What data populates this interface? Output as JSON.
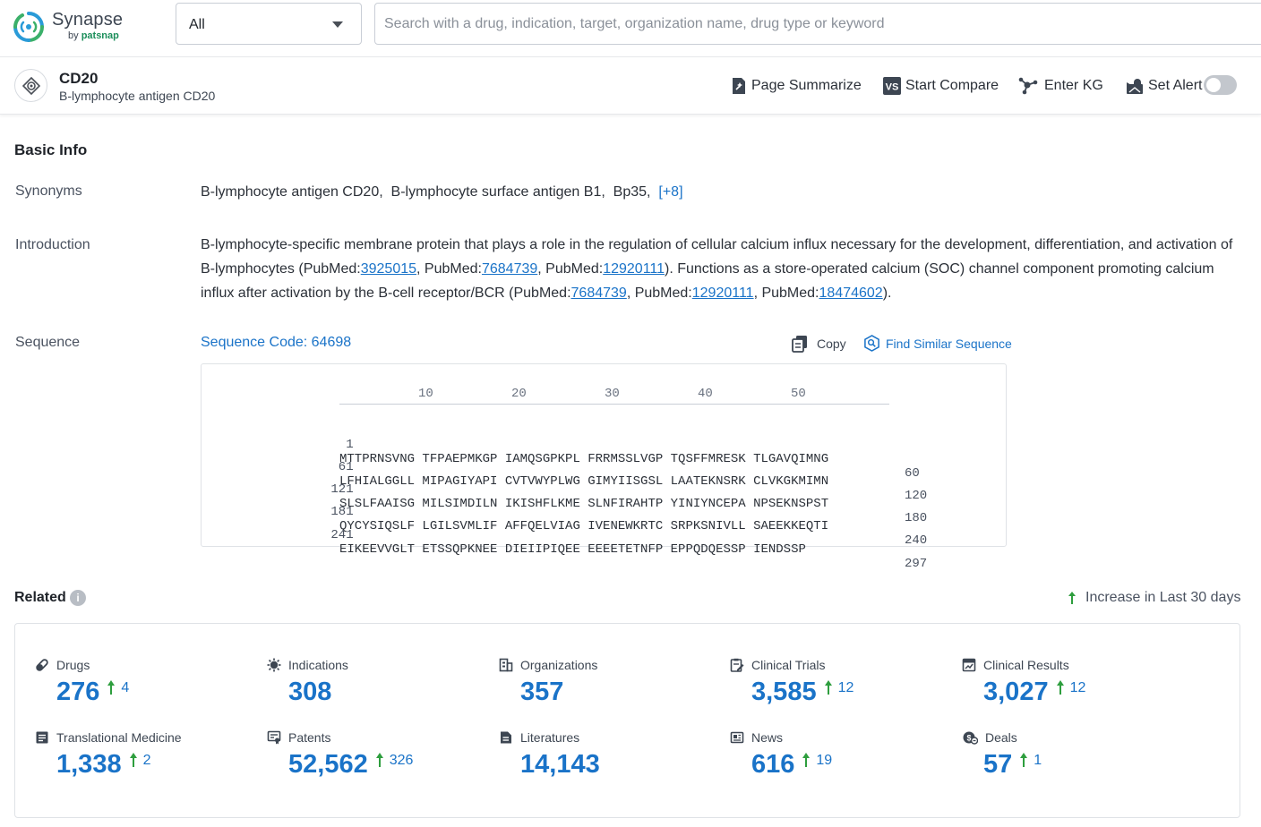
{
  "header": {
    "logo_name": "Synapse",
    "logo_by": "by",
    "logo_brand": "patsnap",
    "scope_value": "All",
    "search_placeholder": "Search with a drug, indication, target, organization name, drug type or keyword"
  },
  "entity": {
    "name": "CD20",
    "full_name": "B-lymphocyte antigen CD20",
    "actions": {
      "summarize": "Page Summarize",
      "compare": "Start Compare",
      "compare_badge": "VS",
      "kg": "Enter KG",
      "alert": "Set Alert",
      "alert_enabled": false
    }
  },
  "basic_info": {
    "title": "Basic Info",
    "synonyms_label": "Synonyms",
    "synonyms_text": "B-lymphocyte antigen CD20,  B-lymphocyte surface antigen B1,  Bp35,",
    "synonyms_more": "[+8]",
    "introduction_label": "Introduction",
    "intro": {
      "p1": "B-lymphocyte-specific membrane protein that plays a role in the regulation of cellular calcium influx necessary for the development, differentiation, and activation of B-lymphocytes (PubMed:",
      "l1": "3925015",
      "p2": ", PubMed:",
      "l2": "7684739",
      "p3": ", PubMed:",
      "l3": "12920111",
      "p4": "). Functions as a store-operated calcium (SOC) channel component promoting calcium influx after activation by the B-cell receptor/BCR (PubMed:",
      "l4": "7684739",
      "p5": ", PubMed:",
      "l5": "12920111",
      "p6": ", PubMed:",
      "l6": "18474602",
      "p7": ")."
    },
    "sequence_label": "Sequence",
    "sequence_code": "Sequence Code: 64698",
    "copy_label": "Copy",
    "find_similar_label": "Find Similar Sequence",
    "ruler_ticks": [
      "10",
      "20",
      "30",
      "40",
      "50"
    ],
    "sequence_rows": [
      {
        "start": "1",
        "residues": "MTTPRNSVNG TFPAEPMKGP IAMQSGPKPL FRRMSSLVGP TQSFFMRESK TLGAVQIMNG",
        "end": "60"
      },
      {
        "start": "61",
        "residues": "LFHIALGGLL MIPAGIYAPI CVTVWYPLWG GIMYIISGSL LAATEKNSRK CLVKGKMIMN",
        "end": "120"
      },
      {
        "start": "121",
        "residues": "SLSLFAAISG MILSIMDILN IKISHFLKME SLNFIRAHTP YINIYNCEPA NPSEKNSPST",
        "end": "180"
      },
      {
        "start": "181",
        "residues": "QYCYSIQSLF LGILSVMLIF AFFQELVIAG IVENEWKRTC SRPKSNIVLL SAEEKKEQTI",
        "end": "240"
      },
      {
        "start": "241",
        "residues": "EIKEEVVGLT ETSSQPKNEE DIEIIPIQEE EEEETETNFP EPPQDQESSP IENDSSP",
        "end": "297"
      }
    ]
  },
  "related": {
    "title": "Related",
    "legend": "Increase in Last 30 days",
    "accent_color": "#1a73c8",
    "increase_color": "#2e9e3e",
    "stats": [
      {
        "label": "Drugs",
        "value": "276",
        "increase": "4",
        "icon": "pill-icon"
      },
      {
        "label": "Indications",
        "value": "308",
        "increase": "",
        "icon": "virus-icon"
      },
      {
        "label": "Organizations",
        "value": "357",
        "increase": "",
        "icon": "building-icon"
      },
      {
        "label": "Clinical Trials",
        "value": "3,585",
        "increase": "12",
        "icon": "clipboard-edit-icon"
      },
      {
        "label": "Clinical Results",
        "value": "3,027",
        "increase": "12",
        "icon": "chart-doc-icon"
      },
      {
        "label": "Translational Medicine",
        "value": "1,338",
        "increase": "2",
        "icon": "doc-list-icon"
      },
      {
        "label": "Patents",
        "value": "52,562",
        "increase": "326",
        "icon": "patent-icon"
      },
      {
        "label": "Literatures",
        "value": "14,143",
        "increase": "",
        "icon": "book-icon"
      },
      {
        "label": "News",
        "value": "616",
        "increase": "19",
        "icon": "newspaper-icon"
      },
      {
        "label": "Deals",
        "value": "57",
        "increase": "1",
        "icon": "handshake-icon"
      }
    ]
  }
}
